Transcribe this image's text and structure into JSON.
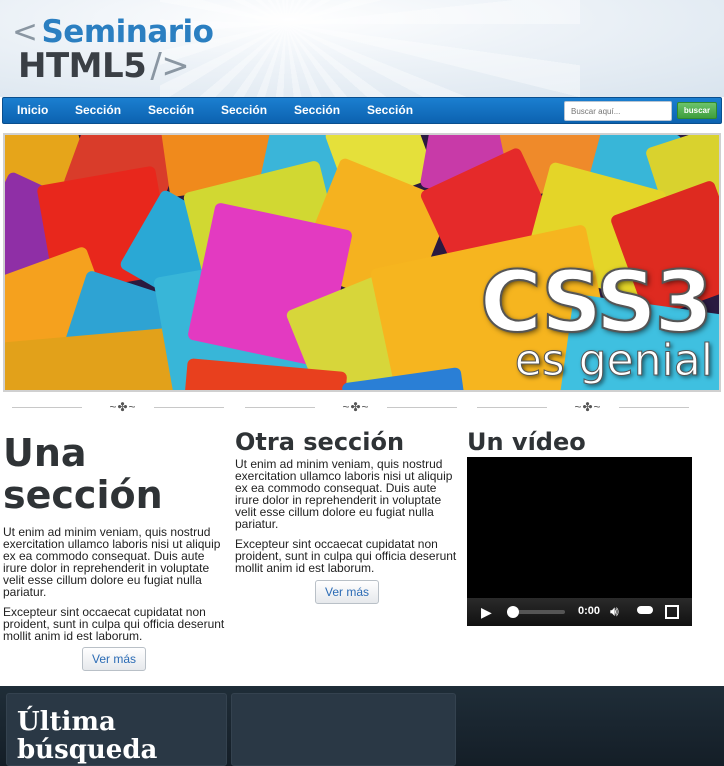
{
  "header": {
    "logo_line1": "Seminario",
    "logo_line1_prefix": "<",
    "logo_line2": "HTML5",
    "logo_line2_suffix": "/>"
  },
  "nav": {
    "items": [
      {
        "label": "Inicio"
      },
      {
        "label": "Sección"
      },
      {
        "label": "Sección"
      },
      {
        "label": "Sección"
      },
      {
        "label": "Sección"
      },
      {
        "label": "Sección"
      }
    ],
    "search_placeholder": "Buscar aquí...",
    "search_button": "buscar"
  },
  "banner": {
    "title": "CSS3",
    "subtitle": "es genial"
  },
  "sections": [
    {
      "title": "Una sección",
      "paragraphs": [
        "Ut enim ad minim veniam, quis nostrud exercitation ullamco laboris nisi ut aliquip ex ea commodo consequat. Duis aute irure dolor in reprehenderit in voluptate velit esse cillum dolore eu fugiat nulla pariatur.",
        "Excepteur sint occaecat cupidatat non proident, sunt in culpa qui officia deserunt mollit anim id est laborum."
      ],
      "button": "Ver más"
    },
    {
      "title": "Otra sección",
      "paragraphs": [
        "Ut enim ad minim veniam, quis nostrud exercitation ullamco laboris nisi ut aliquip ex ea commodo consequat. Duis aute irure dolor in reprehenderit in voluptate velit esse cillum dolore eu fugiat nulla pariatur.",
        "Excepteur sint occaecat cupidatat non proident, sunt in culpa qui officia deserunt mollit anim id est laborum."
      ],
      "button": "Ver más"
    },
    {
      "title": "Un vídeo"
    }
  ],
  "video": {
    "time": "0:00",
    "progress": 0
  },
  "footer": {
    "panel_title": "Última búsqueda"
  },
  "colors": {
    "nav": "#1b7fd0",
    "logo_blue": "#2b7fc1",
    "search_button": "#4caf4a",
    "footer": "#1f2d38"
  }
}
